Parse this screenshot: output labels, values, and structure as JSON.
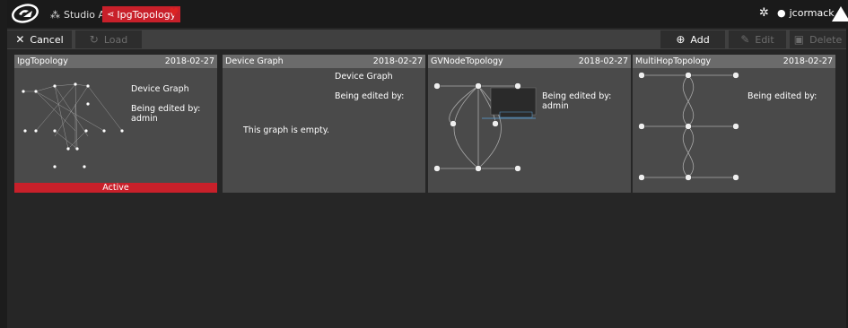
{
  "header": {
    "studio_label": "Studio A",
    "studio_icon": "studio-icon",
    "topology_label": "IpgTopology",
    "topology_icon": "topology-icon",
    "user_name": "jcormack"
  },
  "toolbar": {
    "cancel_label": "Cancel",
    "load_label": "Load",
    "add_label": "Add",
    "edit_label": "Edit",
    "delete_label": "Delete"
  },
  "cards": [
    {
      "name": "IpgTopology",
      "date": "2018-02-27",
      "graph_name": "Device Graph",
      "edited_label": "Being edited by:",
      "edited_by": "admin",
      "status": "Active"
    },
    {
      "name": "Device Graph",
      "date": "2018-02-27",
      "graph_name": "Device Graph",
      "edited_label": "Being edited by:",
      "empty_text": "This graph is empty."
    },
    {
      "name": "GVNodeTopology",
      "date": "2018-02-27",
      "edited_label": "Being edited by:",
      "edited_by": "admin"
    },
    {
      "name": "MultiHopTopology",
      "date": "2018-02-27",
      "edited_label": "Being edited by:"
    }
  ],
  "colors": {
    "accent": "#c8202a",
    "card_bg": "#4a4a4a",
    "card_header": "#6b6b6b",
    "page_bg": "#262626"
  }
}
